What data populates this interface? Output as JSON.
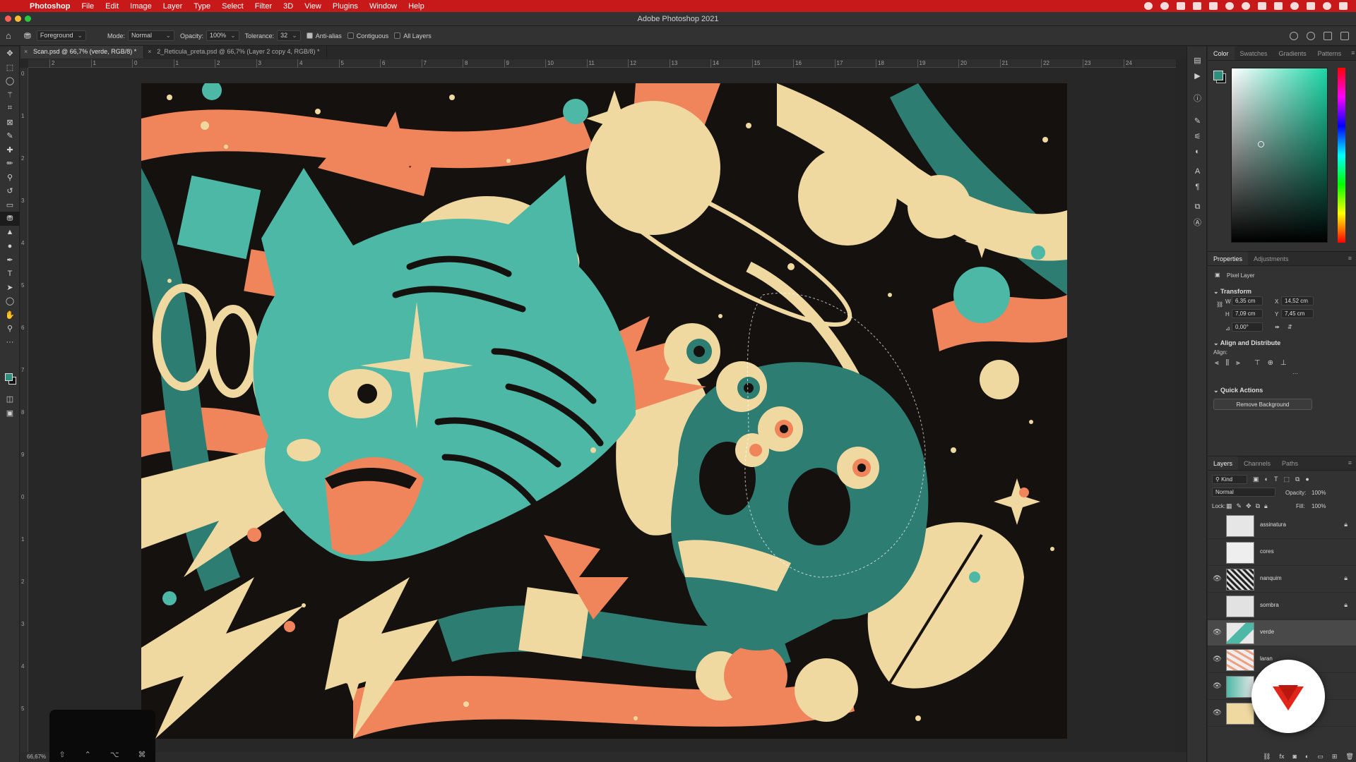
{
  "menubar": {
    "app_name": "Photoshop",
    "items": [
      "File",
      "Edit",
      "Image",
      "Layer",
      "Type",
      "Select",
      "Filter",
      "3D",
      "View",
      "Plugins",
      "Window",
      "Help"
    ]
  },
  "window": {
    "title": "Adobe Photoshop 2021"
  },
  "options_bar": {
    "preset": "Foreground",
    "mode_label": "Mode:",
    "mode_value": "Normal",
    "opacity_label": "Opacity:",
    "opacity_value": "100%",
    "tolerance_label": "Tolerance:",
    "tolerance_value": "32",
    "antialias_label": "Anti-alias",
    "contiguous_label": "Contiguous",
    "all_layers_label": "All Layers"
  },
  "tabs": [
    {
      "label": "Scan.psd @ 66,7% (verde, RGB/8) *",
      "active": true
    },
    {
      "label": "2_Reticula_preta.psd @ 66,7% (Layer 2 copy 4, RGB/8) *",
      "active": false
    }
  ],
  "ruler": {
    "h_labels": [
      "2",
      "1",
      "0",
      "1",
      "2",
      "3",
      "4",
      "5",
      "6",
      "7",
      "8",
      "9",
      "10",
      "11",
      "12",
      "13",
      "14",
      "15",
      "16",
      "17",
      "18",
      "19",
      "20",
      "21",
      "22",
      "23",
      "24"
    ],
    "v_labels": [
      "0",
      "1",
      "2",
      "3",
      "4",
      "5",
      "6",
      "7",
      "8",
      "9",
      "0",
      "1",
      "2",
      "3",
      "4",
      "5"
    ]
  },
  "status": {
    "zoom": "66,67%"
  },
  "touchbar": {
    "keys": [
      "⇧",
      "⌃",
      "⌥",
      "⌘"
    ]
  },
  "color_panel": {
    "tabs": [
      "Color",
      "Swatches",
      "Gradients",
      "Patterns"
    ],
    "foreground": "#2f8f7f",
    "background": "#111111"
  },
  "properties_panel": {
    "tabs": [
      "Properties",
      "Adjustments"
    ],
    "layer_type": "Pixel Layer",
    "transform_title": "Transform",
    "w_label": "W",
    "w_value": "6,35 cm",
    "h_label": "H",
    "h_value": "7,09 cm",
    "x_label": "X",
    "x_value": "14,52 cm",
    "y_label": "Y",
    "y_value": "7,45 cm",
    "angle_value": "0,00°",
    "align_title": "Align and Distribute",
    "align_label": "Align:",
    "quick_actions_title": "Quick Actions",
    "remove_bg_label": "Remove Background"
  },
  "layers_panel": {
    "tabs": [
      "Layers",
      "Channels",
      "Paths"
    ],
    "filter_kind": "Kind",
    "blend_mode": "Normal",
    "opacity_label": "Opacity:",
    "opacity_value": "100%",
    "lock_label": "Lock:",
    "fill_label": "Fill:",
    "fill_value": "100%",
    "layers": [
      {
        "name": "assinatura",
        "visible": false,
        "locked": true,
        "selected": false
      },
      {
        "name": "cores",
        "visible": false,
        "locked": false,
        "selected": false
      },
      {
        "name": "nanquim",
        "visible": true,
        "locked": true,
        "selected": false
      },
      {
        "name": "sombra",
        "visible": false,
        "locked": true,
        "selected": false
      },
      {
        "name": "verde",
        "visible": true,
        "locked": false,
        "selected": true
      },
      {
        "name": "laran",
        "visible": true,
        "locked": false,
        "selected": false
      },
      {
        "name": "",
        "visible": true,
        "locked": false,
        "selected": false
      },
      {
        "name": "",
        "visible": true,
        "locked": false,
        "selected": false
      }
    ]
  },
  "artwork_palette": {
    "ink": "#14110f",
    "teal": "#4db8a6",
    "dark_teal": "#2e7d72",
    "orange": "#f0845a",
    "cream": "#efd9a0"
  }
}
